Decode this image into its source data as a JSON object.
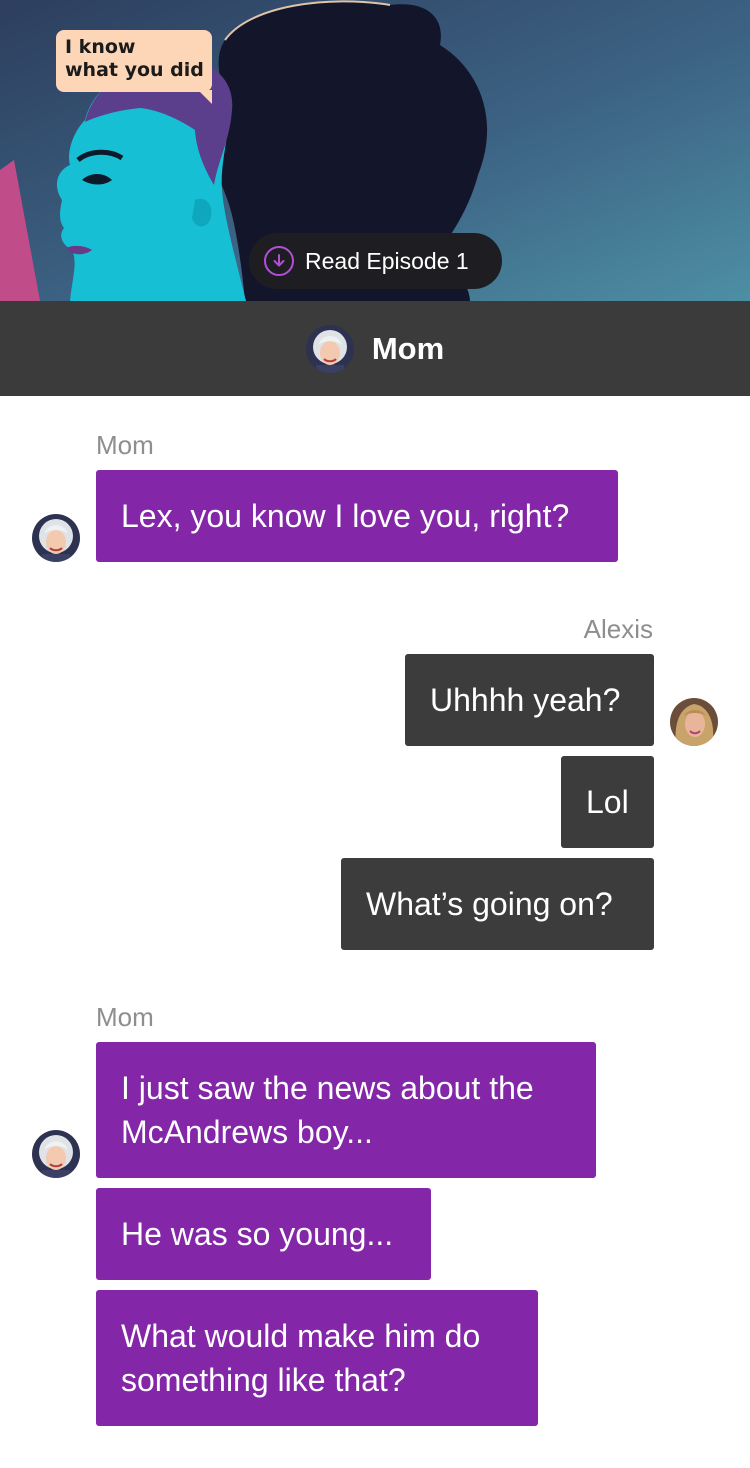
{
  "cover": {
    "speech_line1": "I know",
    "speech_line2": "what you did",
    "read_button_label": "Read Episode 1",
    "download_icon": "download-circle-icon"
  },
  "header": {
    "contact_name": "Mom",
    "avatar_icon": "mom-avatar"
  },
  "messages": [
    {
      "sender": "Mom",
      "side": "left",
      "bubbles": [
        "Lex, you know I love you, right?"
      ]
    },
    {
      "sender": "Alexis",
      "side": "right",
      "bubbles": [
        "Uhhhh yeah?",
        "Lol",
        "What’s going on?"
      ]
    },
    {
      "sender": "Mom",
      "side": "left",
      "bubbles": [
        "I just saw the news about the McAndrews boy...",
        "He was so young...",
        "What would make him do something like that?"
      ]
    }
  ],
  "colors": {
    "mom_bubble": "#8327a8",
    "me_bubble": "#3c3c3c",
    "header_bg": "#3b3b3b",
    "accent": "#b24fd9"
  }
}
